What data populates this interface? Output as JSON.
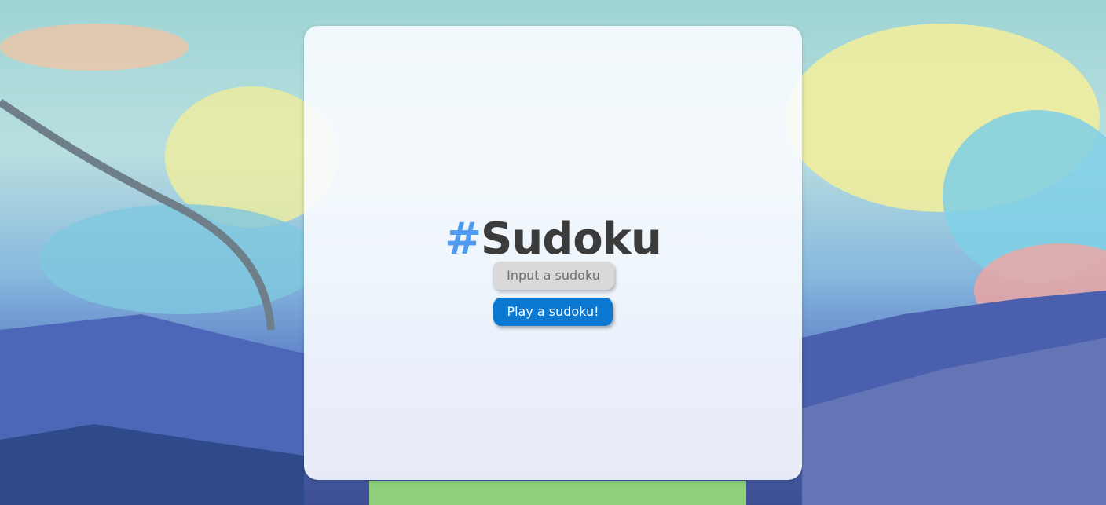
{
  "title": {
    "hash": "#",
    "text": "Sudoku"
  },
  "buttons": {
    "input_label": "Input a sudoku",
    "play_label": "Play a sudoku!"
  },
  "colors": {
    "accent_hash": "#4f9bf2",
    "title_text": "#3b3b3b",
    "input_button_bg": "#d9d9d9",
    "play_button_bg": "#0b78d1"
  }
}
